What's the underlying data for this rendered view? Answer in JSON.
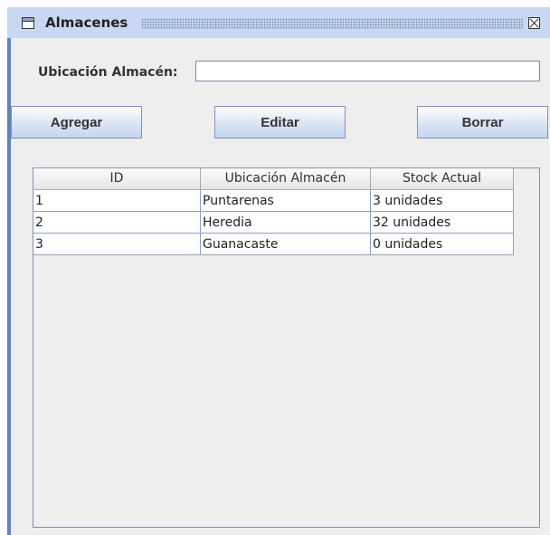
{
  "window": {
    "title": "Almacenes"
  },
  "form": {
    "ubicacion_label": "Ubicación Almacén:",
    "ubicacion_value": ""
  },
  "buttons": {
    "agregar": "Agregar",
    "editar": "Editar",
    "borrar": "Borrar"
  },
  "table": {
    "headers": [
      "ID",
      "Ubicación Almacén",
      "Stock Actual"
    ],
    "rows": [
      [
        "1",
        "Puntarenas",
        "3 unidades"
      ],
      [
        "2",
        "Heredia",
        "32 unidades"
      ],
      [
        "3",
        "Guanacaste",
        "0 unidades"
      ]
    ]
  },
  "colors": {
    "title_bar": "#c8d8f3",
    "frame": "#6382bf",
    "panel": "#eeeeee"
  }
}
